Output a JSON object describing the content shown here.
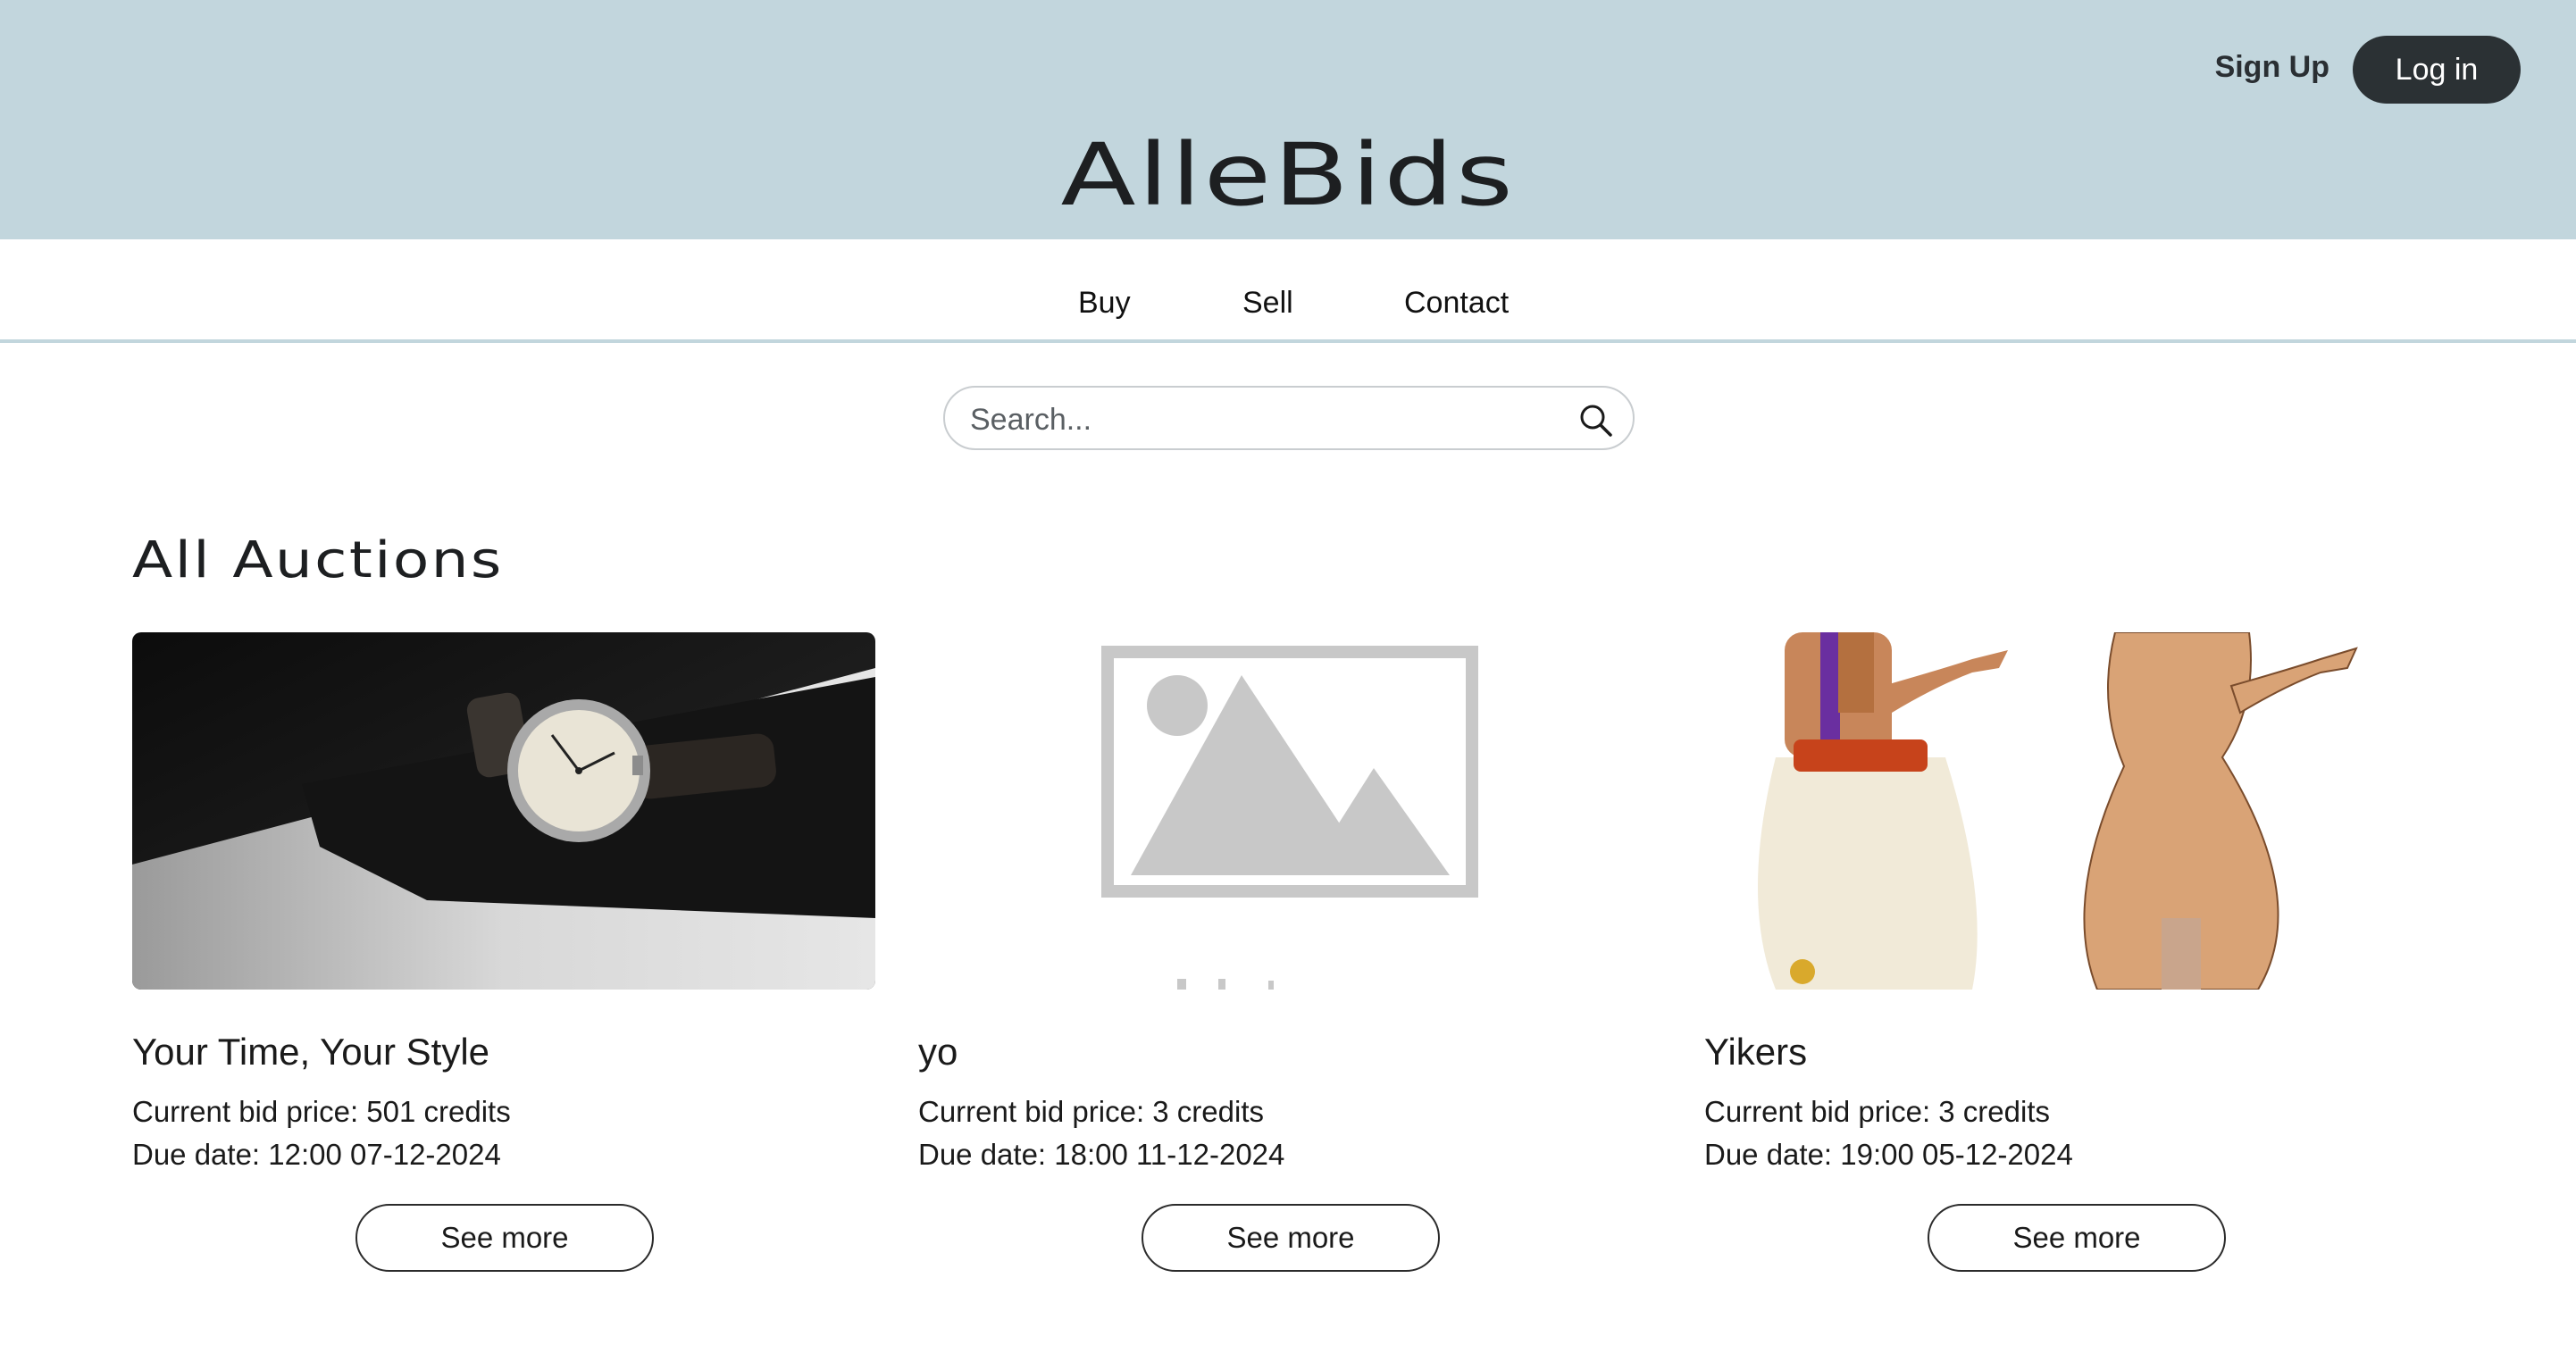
{
  "header": {
    "brand": "AlleBids",
    "signup_label": "Sign Up",
    "login_label": "Log in",
    "background_color": "#c2d6dd"
  },
  "nav": {
    "items": [
      {
        "label": "Buy"
      },
      {
        "label": "Sell"
      },
      {
        "label": "Contact"
      }
    ]
  },
  "search": {
    "placeholder": "Search...",
    "icon": "search-icon"
  },
  "main": {
    "section_title": "All Auctions",
    "auctions": [
      {
        "title": "Your Time, Your Style",
        "price": "Current bid price: 501 credits",
        "due": "Due date: 12:00 07-12-2024",
        "button": "See more",
        "image": "wristwatch-photo"
      },
      {
        "title": "yo",
        "price": "Current bid price: 3 credits",
        "due": "Due date: 18:00 11-12-2024",
        "button": "See more",
        "image": "no-image-placeholder"
      },
      {
        "title": "Yikers",
        "price": "Current bid price: 3 credits",
        "due": "Due date: 19:00 05-12-2024",
        "button": "See more",
        "image": "cartoon-character-illustration"
      }
    ]
  }
}
